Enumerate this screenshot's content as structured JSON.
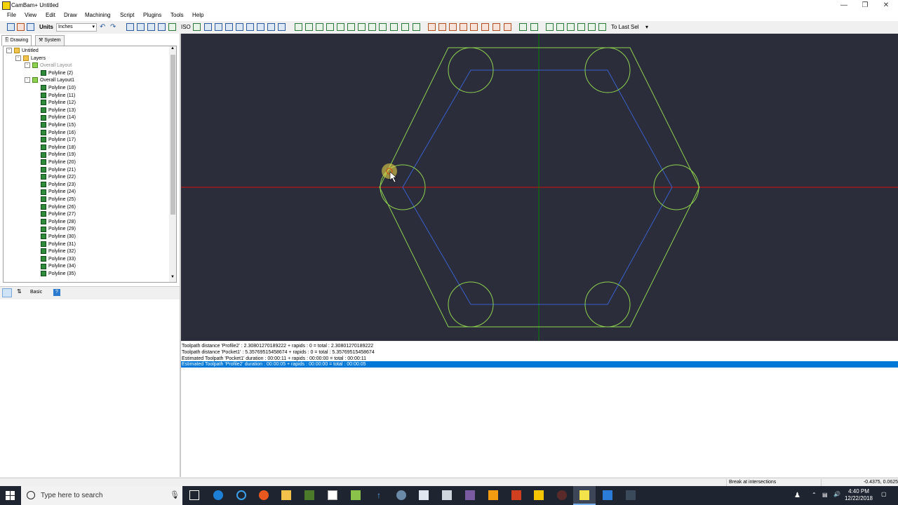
{
  "window": {
    "title": "CamBam+ Untitled",
    "controls": [
      "minimize",
      "restore",
      "close"
    ]
  },
  "menu": [
    "File",
    "View",
    "Edit",
    "Draw",
    "Machining",
    "Script",
    "Plugins",
    "Tools",
    "Help"
  ],
  "toolbar": {
    "units_label": "Units",
    "units_value": "Inches",
    "iso_label": "ISO",
    "to_last_sel": "To Last Sel"
  },
  "left_panel": {
    "tabs": [
      "Drawing",
      "System"
    ],
    "tree": {
      "root": "Untitled",
      "layers": "Layers",
      "layout0": "Overall Layout",
      "layout0_item": "Polyline (2)",
      "layout1": "Overall Layout1",
      "polylines": [
        "Polyline (10)",
        "Polyline (11)",
        "Polyline (12)",
        "Polyline (13)",
        "Polyline (14)",
        "Polyline (15)",
        "Polyline (16)",
        "Polyline (17)",
        "Polyline (18)",
        "Polyline (19)",
        "Polyline (20)",
        "Polyline (21)",
        "Polyline (22)",
        "Polyline (23)",
        "Polyline (24)",
        "Polyline (25)",
        "Polyline (26)",
        "Polyline (27)",
        "Polyline (28)",
        "Polyline (29)",
        "Polyline (30)",
        "Polyline (31)",
        "Polyline (32)",
        "Polyline (33)",
        "Polyline (34)",
        "Polyline (35)"
      ]
    },
    "props_label": "Basic"
  },
  "output": [
    "Toolpath distance 'Profile2' : 2.30801270189222 + rapids : 0 = total : 2.30801270189222",
    "Toolpath distance 'Pocket1' : 5.35769515458674 + rapids : 0 = total : 5.35769515458674",
    "Estimated Toolpath 'Pocket1' duration : 00:00:11 + rapids : 00:00:00 = total : 00:00:11",
    "Estimated Toolpath 'Profile2' duration : 00:00:05 + rapids : 00:00:00 = total : 00:00:05"
  ],
  "status": {
    "hint": "Break at intersections",
    "coords": "-0.4375, 0.0625"
  },
  "taskbar": {
    "search_placeholder": "Type here to search",
    "time": "4:40 PM",
    "date": "12/22/2018"
  },
  "colors": {
    "canvas_bg": "#2b2e3a",
    "geometry": "#8fd14f",
    "toolpath": "#3a5fcd",
    "x_axis": "#d01010",
    "y_axis": "#0a7a0a",
    "selection": "#0078d7"
  }
}
